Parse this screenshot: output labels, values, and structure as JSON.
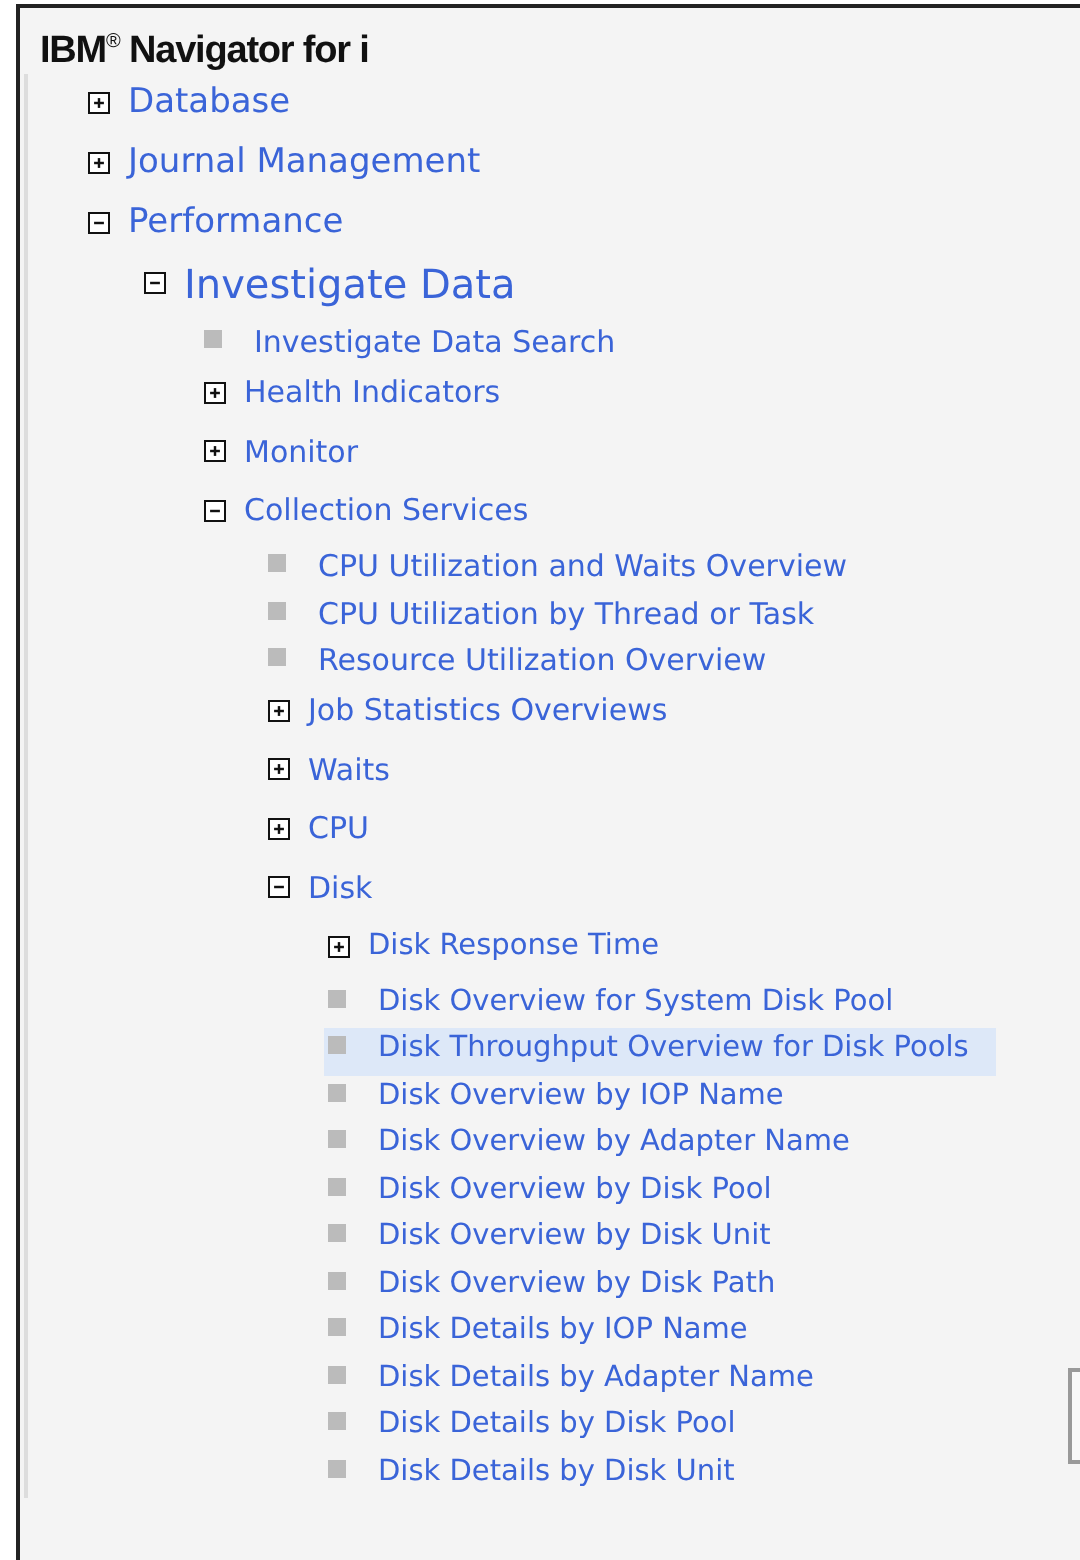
{
  "window": {
    "title": "IBM$^{®}$ Navigator for i"
  },
  "tree": [
    {
      "label": "Database",
      "kind": "folder",
      "expanded": false
    },
    {
      "label": "Journal Management",
      "kind": "folder",
      "expanded": false
    },
    {
      "label": "Performance",
      "kind": "folder",
      "expanded": true,
      "children": [
        {
          "label": "Investigate Data",
          "kind": "folder",
          "expanded": true,
          "children": [
            {
              "label": "Investigate Data Search",
              "kind": "leaf",
              "selected": false
            },
            {
              "label": "Health Indicators",
              "kind": "folder",
              "expanded": false
            },
            {
              "label": "Monitor",
              "kind": "folder",
              "expanded": false
            },
            {
              "label": "Collection Services",
              "kind": "folder",
              "expanded": true,
              "children": [
                {
                  "label": "CPU Utilization and Waits Overview",
                  "kind": "leaf",
                  "selected": false
                },
                {
                  "label": "CPU Utilization by Thread or Task",
                  "kind": "leaf",
                  "selected": false
                },
                {
                  "label": "Resource Utilization Overview",
                  "kind": "leaf",
                  "selected": false
                },
                {
                  "label": "Job Statistics Overviews",
                  "kind": "folder",
                  "expanded": false
                },
                {
                  "label": "Waits",
                  "kind": "folder",
                  "expanded": false
                },
                {
                  "label": "CPU",
                  "kind": "folder",
                  "expanded": false
                },
                {
                  "label": "Disk",
                  "kind": "folder",
                  "expanded": true,
                  "children": [
                    {
                      "label": "Disk Response Time",
                      "kind": "folder",
                      "expanded": false
                    },
                    {
                      "label": "Disk Overview for System Disk Pool",
                      "kind": "leaf",
                      "selected": false
                    },
                    {
                      "label": "Disk Throughput Overview for Disk Pools",
                      "kind": "leaf",
                      "selected": true
                    },
                    {
                      "label": "Disk Overview by IOP Name",
                      "kind": "leaf",
                      "selected": false
                    },
                    {
                      "label": "Disk Overview by Adapter Name",
                      "kind": "leaf",
                      "selected": false
                    },
                    {
                      "label": "Disk Overview by Disk Pool",
                      "kind": "leaf",
                      "selected": false
                    },
                    {
                      "label": "Disk Overview by Disk Unit",
                      "kind": "leaf",
                      "selected": false
                    },
                    {
                      "label": "Disk Overview by Disk Path",
                      "kind": "leaf",
                      "selected": false
                    },
                    {
                      "label": "Disk Details by IOP Name",
                      "kind": "leaf",
                      "selected": false
                    },
                    {
                      "label": "Disk Details by Adapter Name",
                      "kind": "leaf",
                      "selected": false
                    },
                    {
                      "label": "Disk Details by Disk Pool",
                      "kind": "leaf",
                      "selected": false
                    },
                    {
                      "label": "Disk Details by Disk Unit",
                      "kind": "leaf",
                      "selected": false
                    }
                  ]
                }
              ]
            }
          ]
        }
      ]
    }
  ]
}
